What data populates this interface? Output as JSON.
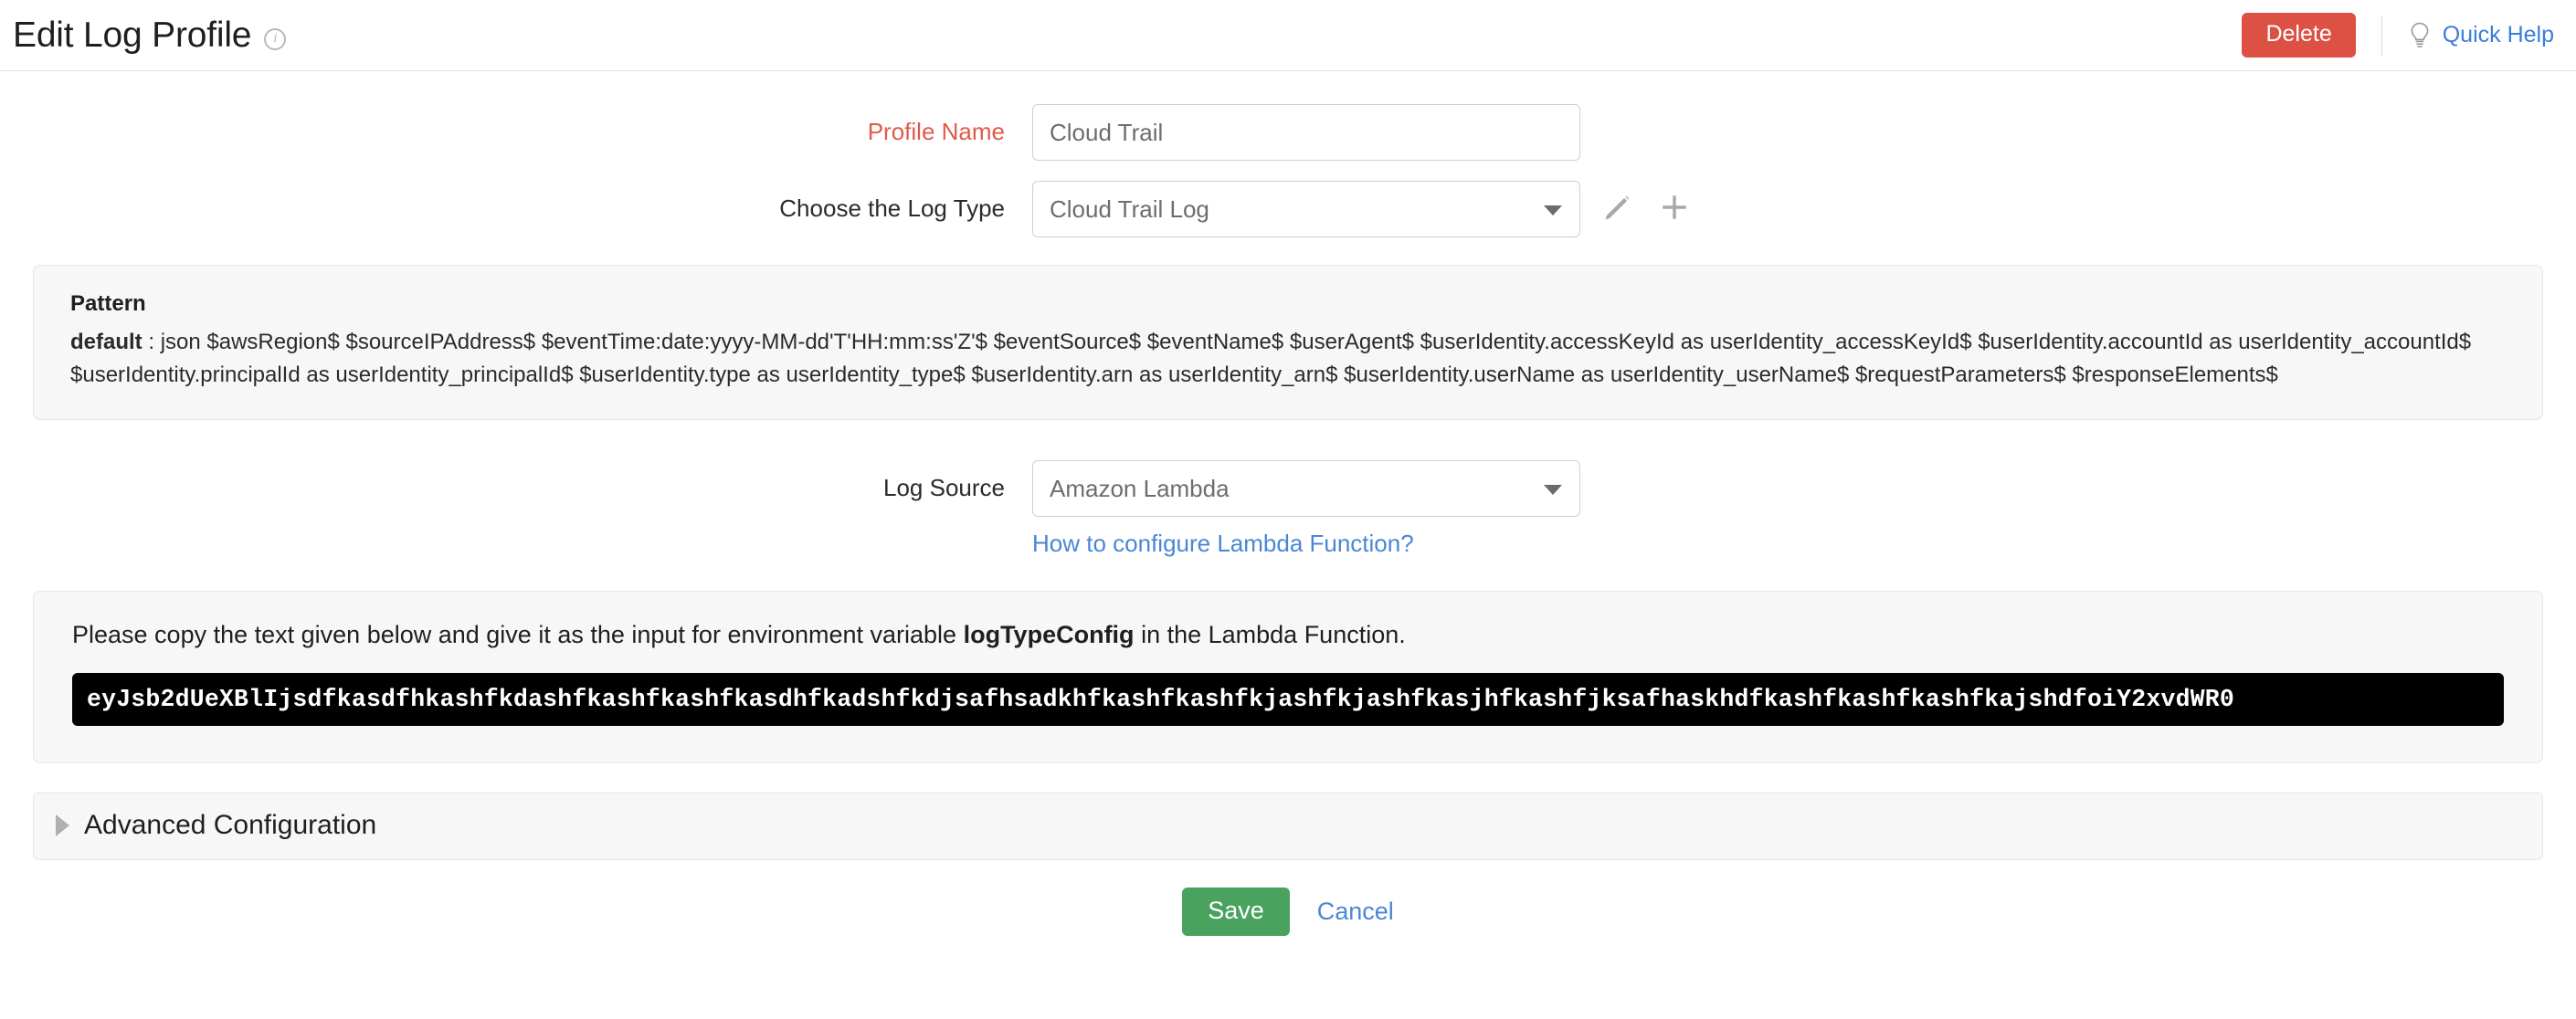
{
  "header": {
    "title": "Edit Log Profile",
    "info_icon": "info-circle-icon",
    "delete_label": "Delete",
    "quick_help_label": "Quick Help",
    "quick_help_icon": "lightbulb-icon",
    "delete_color": "#dd5145",
    "link_color": "#3b7ddd"
  },
  "form": {
    "profile_name": {
      "label": "Profile Name",
      "value": "Cloud Trail",
      "placeholder": "Profile Name",
      "required": true,
      "label_color": "#e2594a"
    },
    "log_type": {
      "label": "Choose the Log Type",
      "value": "Cloud Trail Log",
      "edit_icon": "pencil-icon",
      "add_icon": "plus-icon"
    },
    "log_source": {
      "label": "Log Source",
      "value": "Amazon Lambda",
      "helper_link": "How to configure Lambda Function?"
    }
  },
  "pattern": {
    "title": "Pattern",
    "name": "default",
    "separator": " : ",
    "value": "json $awsRegion$ $sourceIPAddress$ $eventTime:date:yyyy-MM-dd'T'HH:mm:ss'Z'$ $eventSource$ $eventName$ $userAgent$ $userIdentity.accessKeyId as userIdentity_accessKeyId$ $userIdentity.accountId as userIdentity_accountId$ $userIdentity.principalId as userIdentity_principalId$ $userIdentity.type as userIdentity_type$ $userIdentity.arn as userIdentity_arn$ $userIdentity.userName as userIdentity_userName$ $requestParameters$ $responseElements$"
  },
  "lambda": {
    "text_before": "Please copy the text given below and give it as the input for environment variable ",
    "variable": "logTypeConfig",
    "text_after": " in the Lambda Function.",
    "code": "eyJsb2dUeXBlIjsdfkasdfhkashfkdashfkashfkashfkasdhfkadshfkdjsafhsadkhfkashfkashfkjashfkjashfkasjhfkashfjksafhaskhdfkashfkashfkashfkajshdfoiY2xvdWR0"
  },
  "advanced": {
    "label": "Advanced Configuration",
    "chevron_icon": "chevron-right-icon",
    "expanded": false
  },
  "footer": {
    "save_label": "Save",
    "cancel_label": "Cancel",
    "save_color": "#49a25e"
  }
}
